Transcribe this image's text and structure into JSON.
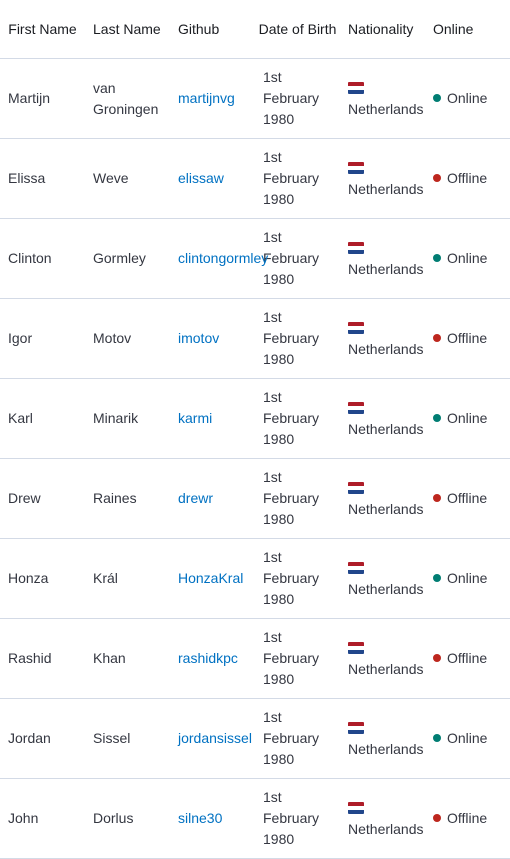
{
  "headers": {
    "first_name": "First Name",
    "last_name": "Last Name",
    "github": "Github",
    "dob": "Date of Birth",
    "nationality": "Nationality",
    "online": "Online"
  },
  "colors": {
    "link": "#0071c2",
    "online": "#017d73",
    "offline": "#bd271e",
    "flag_red": "#ae1c28",
    "flag_white": "#ffffff",
    "flag_blue": "#21468b"
  },
  "flag_icon": "netherlands-flag-icon",
  "rows": [
    {
      "first": "Martijn",
      "last": "van Groningen",
      "github": "martijnvg",
      "dob": "1st February 1980",
      "nationality": "Netherlands",
      "status": "Online",
      "online": true
    },
    {
      "first": "Elissa",
      "last": "Weve",
      "github": "elissaw",
      "dob": "1st February 1980",
      "nationality": "Netherlands",
      "status": "Offline",
      "online": false
    },
    {
      "first": "Clinton",
      "last": "Gormley",
      "github": "clintongormley",
      "dob": "1st February 1980",
      "nationality": "Netherlands",
      "status": "Online",
      "online": true
    },
    {
      "first": "Igor",
      "last": "Motov",
      "github": "imotov",
      "dob": "1st February 1980",
      "nationality": "Netherlands",
      "status": "Offline",
      "online": false
    },
    {
      "first": "Karl",
      "last": "Minarik",
      "github": "karmi",
      "dob": "1st February 1980",
      "nationality": "Netherlands",
      "status": "Online",
      "online": true
    },
    {
      "first": "Drew",
      "last": "Raines",
      "github": "drewr",
      "dob": "1st February 1980",
      "nationality": "Netherlands",
      "status": "Offline",
      "online": false
    },
    {
      "first": "Honza",
      "last": "Král",
      "github": "HonzaKral",
      "dob": "1st February 1980",
      "nationality": "Netherlands",
      "status": "Online",
      "online": true
    },
    {
      "first": "Rashid",
      "last": "Khan",
      "github": "rashidkpc",
      "dob": "1st February 1980",
      "nationality": "Netherlands",
      "status": "Offline",
      "online": false
    },
    {
      "first": "Jordan",
      "last": "Sissel",
      "github": "jordansissel",
      "dob": "1st February 1980",
      "nationality": "Netherlands",
      "status": "Online",
      "online": true
    },
    {
      "first": "John",
      "last": "Dorlus",
      "github": "silne30",
      "dob": "1st February 1980",
      "nationality": "Netherlands",
      "status": "Offline",
      "online": false
    }
  ]
}
